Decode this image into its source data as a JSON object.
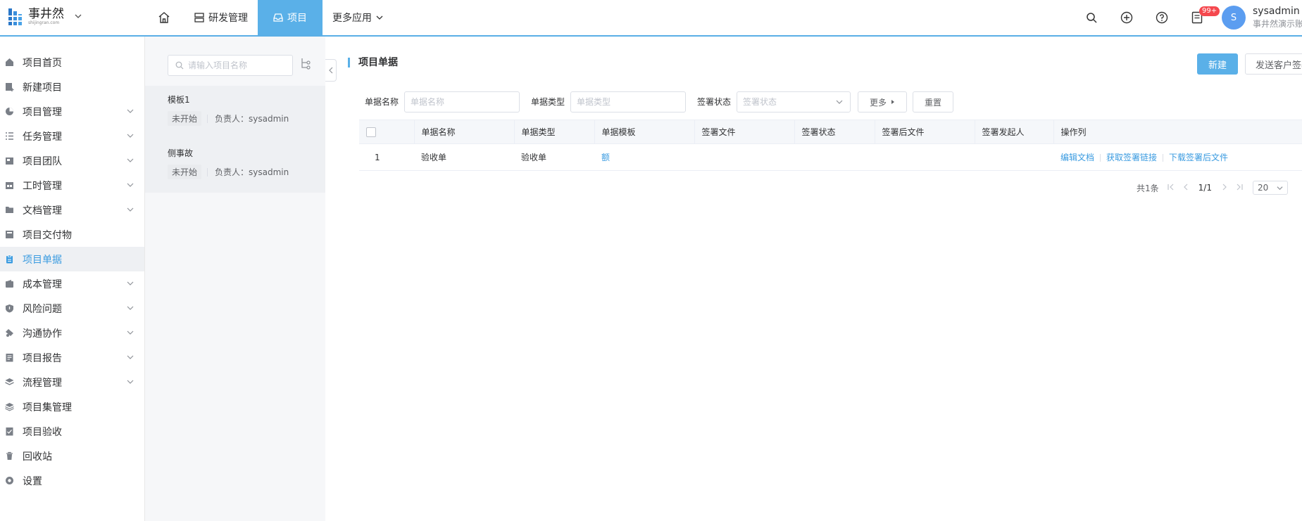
{
  "brand": {
    "name": "事井然",
    "sub": "shijingran.com"
  },
  "nav": {
    "items": [
      {
        "label": "研发管理"
      },
      {
        "label": "项目"
      },
      {
        "label": "更多应用"
      }
    ]
  },
  "header": {
    "badge": "99+",
    "avatar_letter": "S",
    "user_name": "sysadmin",
    "user_org": "事井然演示账户"
  },
  "sidebar": {
    "items": [
      {
        "label": "项目首页"
      },
      {
        "label": "新建项目"
      },
      {
        "label": "项目管理"
      },
      {
        "label": "任务管理"
      },
      {
        "label": "项目团队"
      },
      {
        "label": "工时管理"
      },
      {
        "label": "文档管理"
      },
      {
        "label": "项目交付物"
      },
      {
        "label": "项目单据"
      },
      {
        "label": "成本管理"
      },
      {
        "label": "风险问题"
      },
      {
        "label": "沟通协作"
      },
      {
        "label": "项目报告"
      },
      {
        "label": "流程管理"
      },
      {
        "label": "项目集管理"
      },
      {
        "label": "项目验收"
      },
      {
        "label": "回收站"
      },
      {
        "label": "设置"
      }
    ]
  },
  "project_list": {
    "search_placeholder": "请输入项目名称",
    "projects": [
      {
        "name": "模板1",
        "status": "未开始",
        "owner": "负责人：sysadmin"
      },
      {
        "name": "侧事故",
        "status": "未开始",
        "owner": "负责人：sysadmin"
      }
    ]
  },
  "main": {
    "title": "项目单据",
    "new_button": "新建",
    "send_button": "发送客户签署",
    "filters": {
      "name_label": "单据名称",
      "name_placeholder": "单据名称",
      "type_label": "单据类型",
      "type_placeholder": "单据类型",
      "status_label": "签署状态",
      "status_placeholder": "签署状态",
      "more_button": "更多",
      "reset_button": "重置"
    },
    "table": {
      "columns": [
        "单据名称",
        "单据类型",
        "单据模板",
        "签署文件",
        "签署状态",
        "签署后文件",
        "签署发起人",
        "操作列"
      ],
      "rows": [
        {
          "index": "1",
          "name": "验收单",
          "type": "验收单",
          "template": "额",
          "file": "",
          "status": "",
          "signed_file": "",
          "initiator": "",
          "ops": [
            "编辑文档",
            "获取签署链接",
            "下载签署后文件"
          ]
        }
      ]
    },
    "pager": {
      "total": "共1条",
      "page": "1/1",
      "size": "20"
    }
  }
}
